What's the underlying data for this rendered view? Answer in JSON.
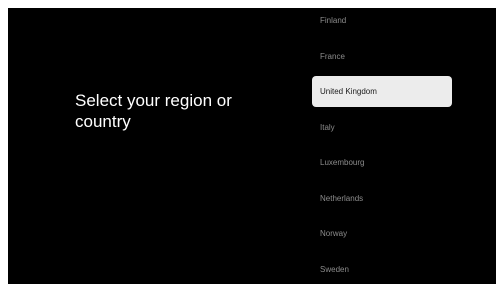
{
  "page": {
    "heading": "Select your region or country"
  },
  "regions": {
    "items": [
      {
        "label": "Finland",
        "selected": false
      },
      {
        "label": "France",
        "selected": false
      },
      {
        "label": "United Kingdom",
        "selected": true
      },
      {
        "label": "Italy",
        "selected": false
      },
      {
        "label": "Luxembourg",
        "selected": false
      },
      {
        "label": "Netherlands",
        "selected": false
      },
      {
        "label": "Norway",
        "selected": false
      },
      {
        "label": "Sweden",
        "selected": false
      }
    ]
  },
  "colors": {
    "background": "#000000",
    "heading_text": "#ffffff",
    "item_text": "#8c8c8c",
    "selected_background": "#ececec",
    "selected_text": "#1a1a1a"
  }
}
